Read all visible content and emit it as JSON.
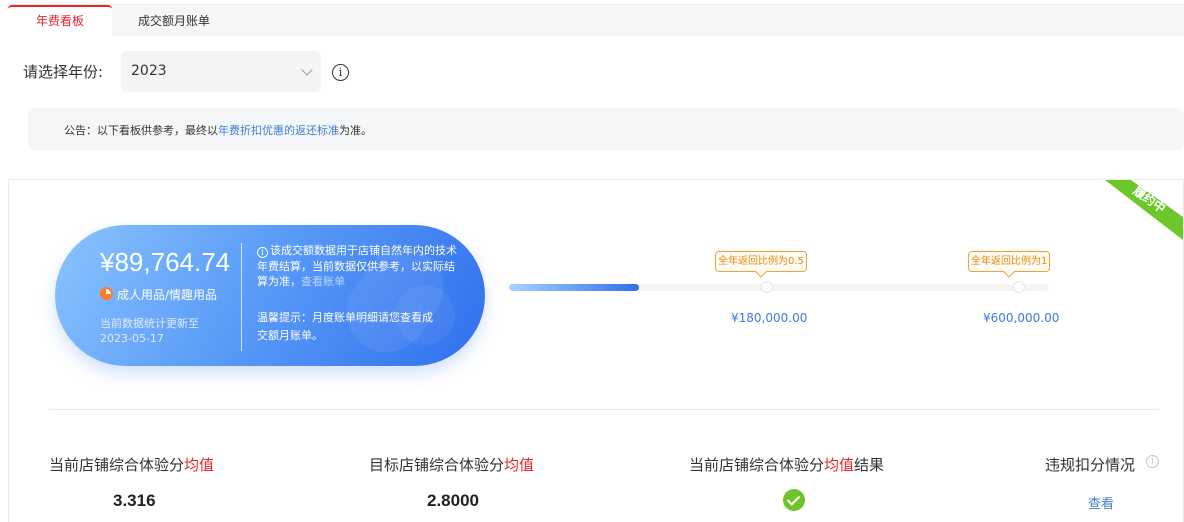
{
  "tabs": [
    {
      "label": "年费看板",
      "active": true
    },
    {
      "label": "成交额月账单",
      "active": false
    }
  ],
  "year_selector": {
    "label": "请选择年份:",
    "value": "2023"
  },
  "notice": {
    "prefix": "公告：以下看板供参考，最终以",
    "link": "年费折扣优惠的返还标准",
    "suffix": "为准。"
  },
  "status_ribbon": "履约中",
  "summary": {
    "amount": "¥89,764.74",
    "category": "成人用品/情趣用品",
    "update_note": "当前数据统计更新至 2023-05-17",
    "tip": "该成交额数据用于店铺自然年内的技术年费结算，当前数据仅供参考，以实际结算为准，",
    "tip_link": "查看账单",
    "reminder": "温馨提示：月度账单明细请您查看成交额月账单。"
  },
  "progress": {
    "current_fraction": 0.24,
    "tiers": [
      {
        "badge": "全年返回比例为0.5",
        "amount": "¥180,000.00"
      },
      {
        "badge": "全年返回比例为1",
        "amount": "¥600,000.00"
      }
    ]
  },
  "metrics": [
    {
      "label_prefix": "当前店铺综合体验分",
      "highlight": "均值",
      "label_suffix": "",
      "value": "3.316"
    },
    {
      "label_prefix": "目标店铺综合体验分",
      "highlight": "均值",
      "label_suffix": "",
      "value": "2.8000"
    },
    {
      "label_prefix": "当前店铺综合体验分",
      "highlight": "均值",
      "label_suffix": "结果",
      "result_icon": "check-circle-icon"
    },
    {
      "label_prefix": "违规扣分情况",
      "highlight": "",
      "label_suffix": "",
      "link": "查看"
    }
  ],
  "colors": {
    "accent": "#e5262e",
    "link": "#3b7ddc",
    "success": "#70c32d",
    "ribbon": "#6cc72a",
    "tier_badge": "#f0a43a"
  }
}
